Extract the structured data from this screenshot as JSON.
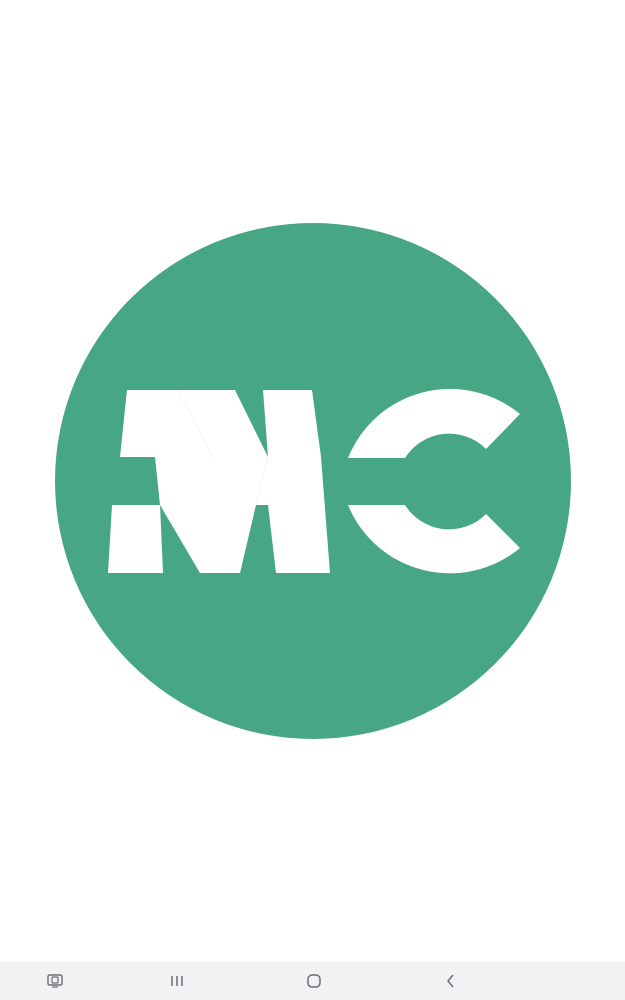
{
  "app": {
    "logo_text": "MC",
    "logo_color": "#47a683",
    "logo_letter_color": "#ffffff",
    "background": "#ffffff"
  },
  "navigation_bar": {
    "background": "#f2f1f4",
    "icon_color": "#6d6d72",
    "buttons": [
      {
        "name": "screenshot-assist",
        "icon": "screenshot-icon"
      },
      {
        "name": "recent-apps",
        "icon": "recents-icon"
      },
      {
        "name": "home",
        "icon": "home-icon"
      },
      {
        "name": "back",
        "icon": "back-icon"
      }
    ]
  }
}
